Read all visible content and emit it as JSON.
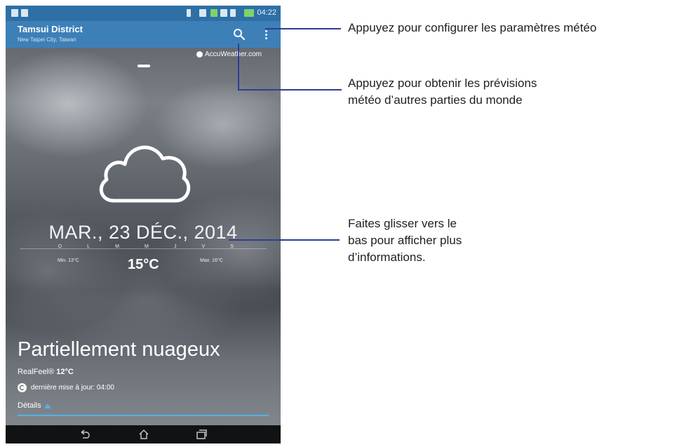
{
  "status_bar": {
    "time": "04:22"
  },
  "app_bar": {
    "location": "Tamsui District",
    "sublocation": "New Taipei City, Taiwan",
    "search_icon": "search-icon",
    "menu_icon": "overflow-menu-icon"
  },
  "provider": "AccuWeather.com",
  "weather": {
    "date": "MAR., 23 DÉC., 2014",
    "days": [
      "D",
      "L",
      "M",
      "M",
      "J",
      "V",
      "S"
    ],
    "min": "Min. 13°C",
    "max": "Max. 16°C",
    "current_temp": "15°C",
    "condition": "Partiellement nuageux",
    "realfeel_label": "RealFeel®",
    "realfeel_value": "12°C",
    "last_update": "dernière mise à jour: 04:00",
    "details_label": "Détails"
  },
  "annotations": {
    "settings": "Appuyez pour configurer les paramètres météo",
    "world_line1": "Appuyez pour obtenir les prévisions",
    "world_line2": "météo d’autres parties du monde",
    "swipe_line1": "Faites glisser vers le",
    "swipe_line2": "bas pour afficher plus",
    "swipe_line3": "d’informations."
  },
  "colors": {
    "status_bar": "#2e6fa6",
    "app_bar": "#3d80b8",
    "accent": "#4fb3e8",
    "leader_line": "#2c3f93"
  }
}
